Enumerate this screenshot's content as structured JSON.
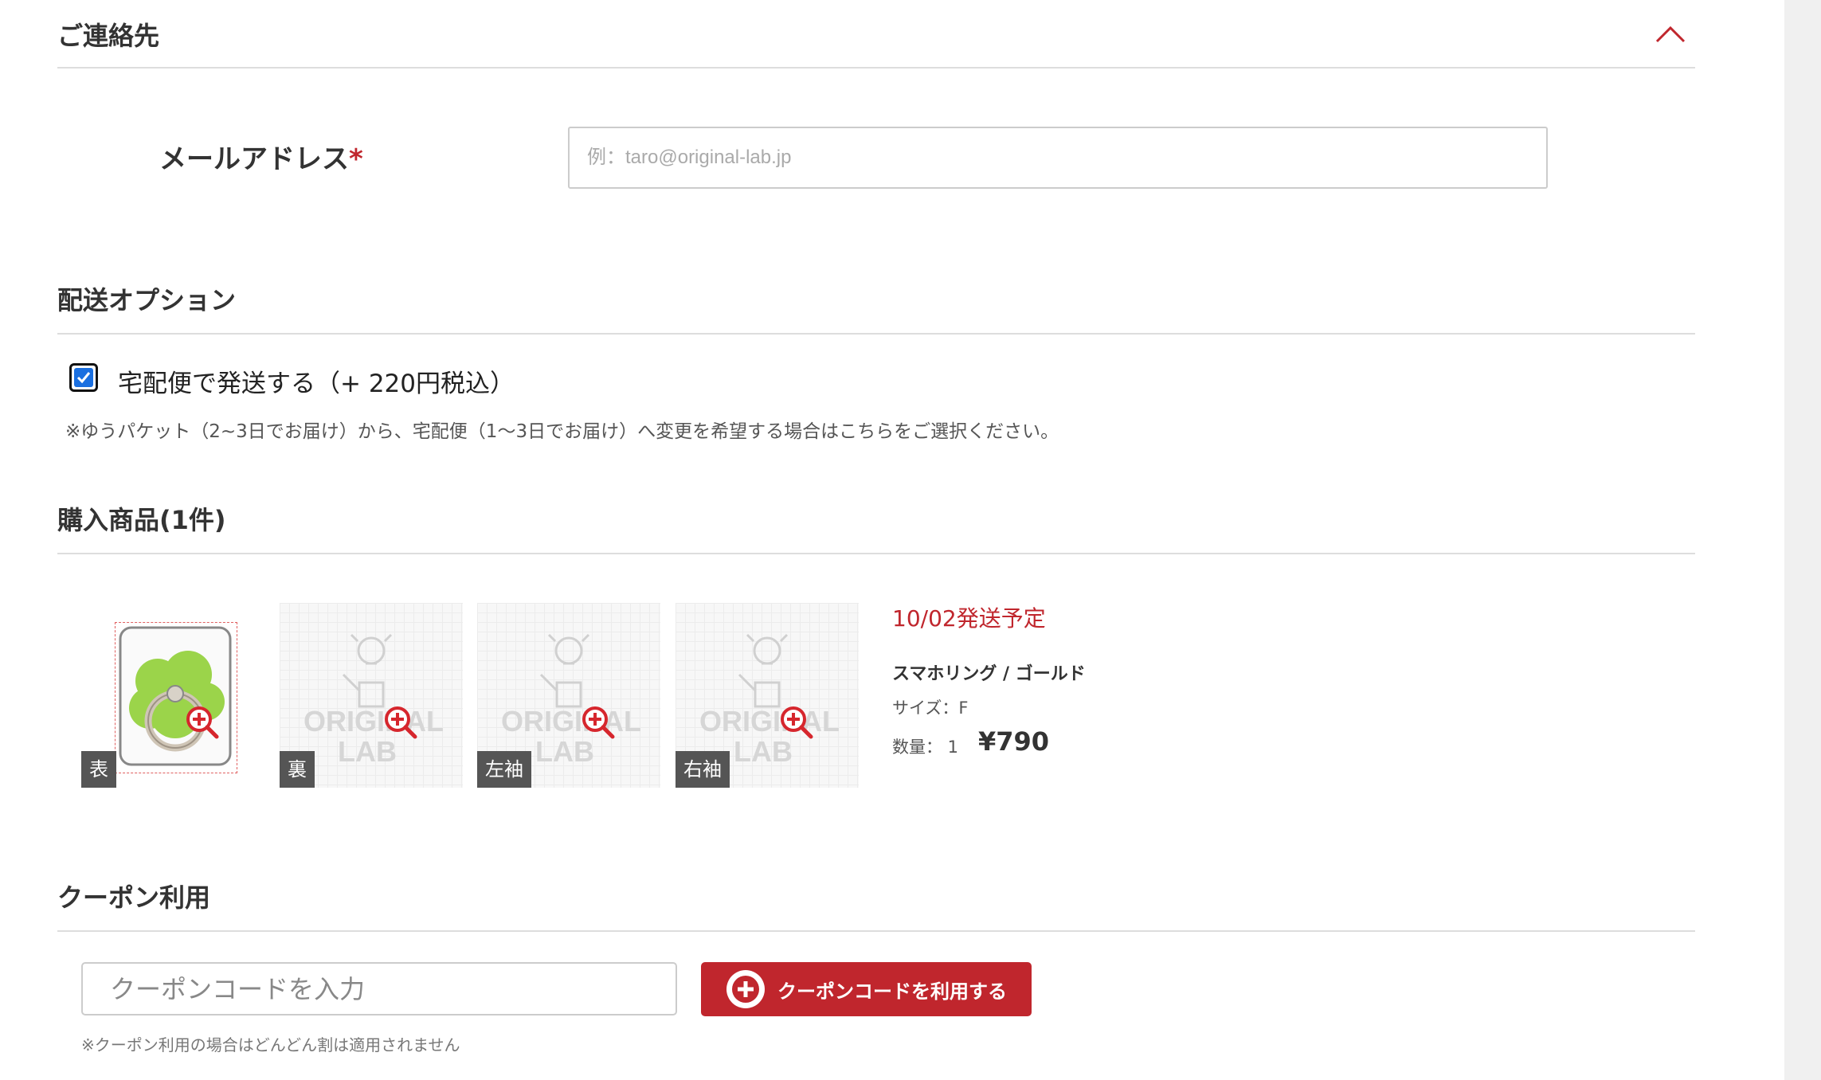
{
  "contact": {
    "title": "ご連絡先",
    "email_label": "メールアドレス",
    "required_mark": "*",
    "email_placeholder": "例：taro@original-lab.jp",
    "email_value": ""
  },
  "shipping": {
    "title": "配送オプション",
    "checkbox_label": "宅配便で発送する（+ 220円税込）",
    "checked": true,
    "note": "※ゆうパケット（2~3日でお届け）から、宅配便（1～3日でお届け）へ変更を希望する場合はこちらをご選択ください。"
  },
  "purchase": {
    "title": "購入商品(1件)",
    "thumbnails": [
      {
        "label": "表",
        "image": "ring-front-image"
      },
      {
        "label": "裏",
        "image": "placeholder"
      },
      {
        "label": "左袖",
        "image": "placeholder"
      },
      {
        "label": "右袖",
        "image": "placeholder"
      }
    ],
    "watermark_line1": "ORIGINAL",
    "watermark_line2": "LAB",
    "ship_date": "10/02発送予定",
    "product_name": "スマホリング / ゴールド",
    "size": "サイズ：F",
    "quantity": "数量： 1",
    "price": "¥790"
  },
  "coupon": {
    "title": "クーポン利用",
    "placeholder": "クーポンコードを入力",
    "value": "",
    "button_label": "クーポンコードを利用する",
    "note": "※クーポン利用の場合はどんどん割は適用されません"
  },
  "colors": {
    "accent": "#c0262d",
    "checkbox": "#1a6fe0",
    "divider": "#dddddd"
  },
  "icons": [
    "chevron-up-icon",
    "check-icon",
    "zoom-in-icon",
    "plus-circle-icon",
    "lightbulb-icon"
  ]
}
